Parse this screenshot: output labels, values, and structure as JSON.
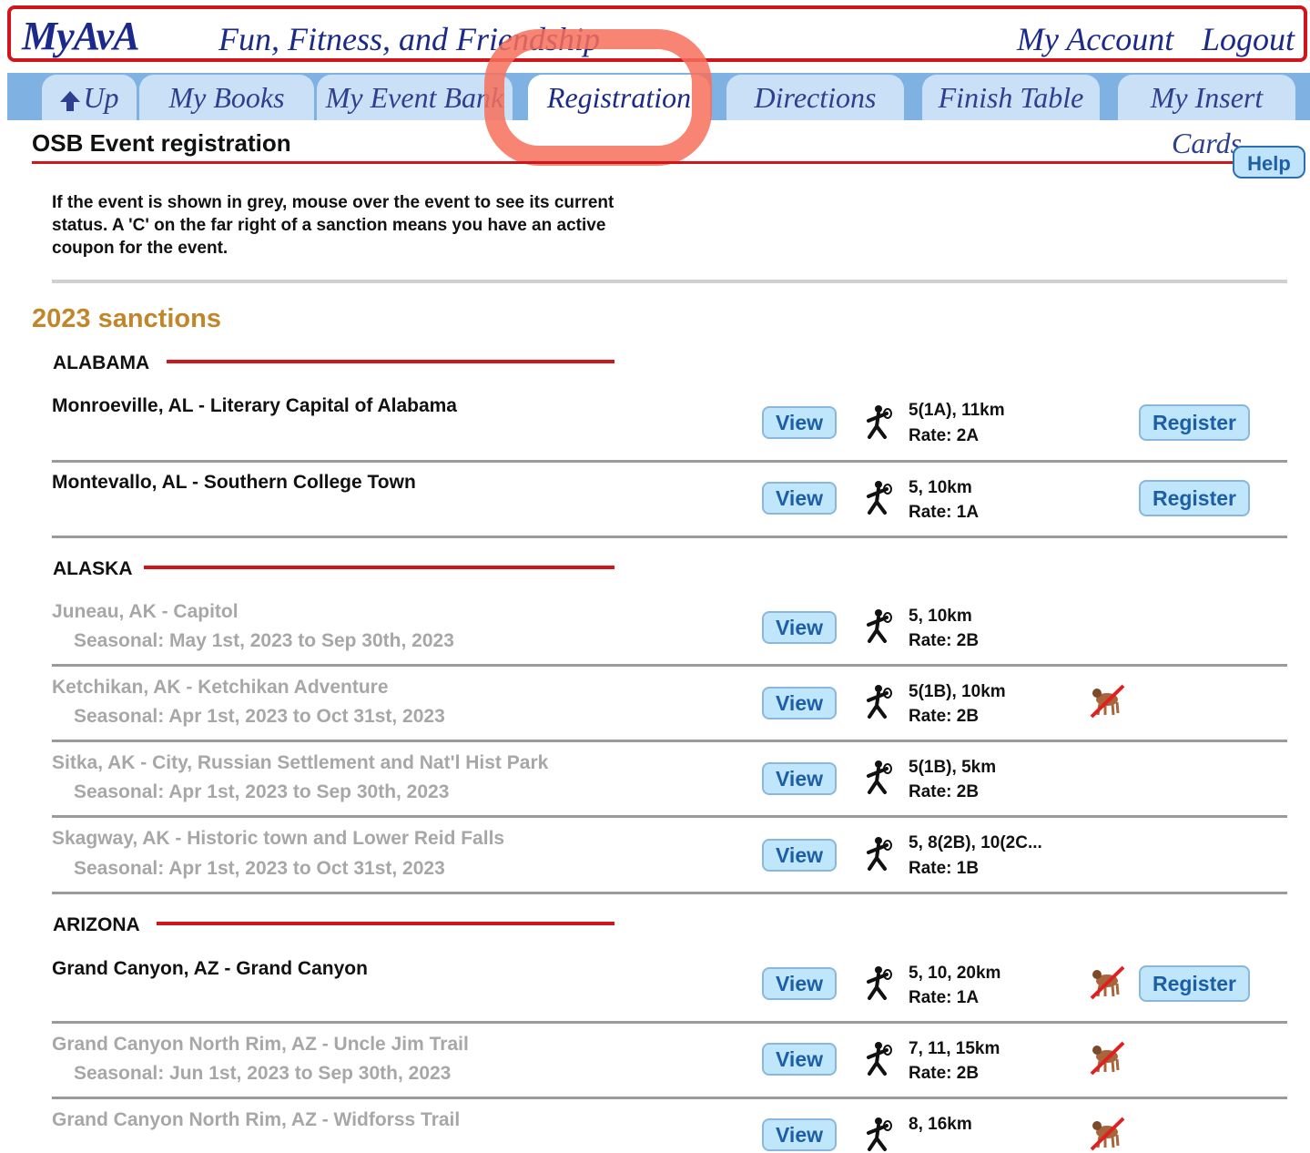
{
  "header": {
    "logo_my": "My",
    "logo_ava": "AvA",
    "tagline": "Fun, Fitness, and Friendship",
    "my_account": "My Account",
    "logout": "Logout"
  },
  "tabs": [
    {
      "label": "Up",
      "icon": "arrow-up-icon"
    },
    {
      "label": "My Books"
    },
    {
      "label": "My Event Bank"
    },
    {
      "label": "Registration",
      "active": true
    },
    {
      "label": "Directions"
    },
    {
      "label": "Finish Table"
    },
    {
      "label": "My Insert Cards"
    }
  ],
  "page": {
    "title": "OSB Event registration",
    "help": "Help",
    "intro": "If the event is shown in grey, mouse over the event to see its current status. A 'C' on the far right of a sanction means you have an active coupon for the event.",
    "year_heading": "2023 sanctions"
  },
  "labels": {
    "view": "View",
    "register": "Register"
  },
  "states": [
    {
      "name": "ALABAMA"
    },
    {
      "name": "ALASKA"
    },
    {
      "name": "ARIZONA"
    }
  ],
  "events": [
    {
      "name": "Monroeville, AL - Literary Capital of Alabama",
      "distance": "5(1A), 11km",
      "rate": "Rate: 2A",
      "register": true,
      "no_dogs": false,
      "grey": false
    },
    {
      "name": "Montevallo, AL - Southern College Town",
      "distance": "5, 10km",
      "rate": "Rate: 1A",
      "register": true,
      "no_dogs": false,
      "grey": false
    },
    {
      "name": "Juneau, AK - Capitol",
      "seasonal": "Seasonal: May 1st, 2023 to Sep 30th, 2023",
      "distance": "5, 10km",
      "rate": "Rate: 2B",
      "register": false,
      "no_dogs": false,
      "grey": true
    },
    {
      "name": "Ketchikan, AK - Ketchikan Adventure",
      "seasonal": "Seasonal: Apr 1st, 2023 to Oct 31st, 2023",
      "distance": "5(1B), 10km",
      "rate": "Rate: 2B",
      "register": false,
      "no_dogs": true,
      "grey": true
    },
    {
      "name": "Sitka, AK - City, Russian Settlement and Nat'l Hist Park",
      "seasonal": "Seasonal: Apr 1st, 2023 to Sep 30th, 2023",
      "distance": "5(1B), 5km",
      "rate": "Rate: 2B",
      "register": false,
      "no_dogs": false,
      "grey": true
    },
    {
      "name": "Skagway, AK - Historic town and Lower Reid Falls",
      "seasonal": "Seasonal: Apr 1st, 2023 to Oct 31st, 2023",
      "distance": "5, 8(2B), 10(2C...",
      "rate": "Rate: 1B",
      "register": false,
      "no_dogs": false,
      "grey": true
    },
    {
      "name": "Grand Canyon, AZ - Grand Canyon",
      "distance": "5, 10, 20km",
      "rate": "Rate: 1A",
      "register": true,
      "no_dogs": true,
      "grey": false
    },
    {
      "name": "Grand Canyon North Rim, AZ - Uncle Jim Trail",
      "seasonal": "Seasonal: Jun 1st, 2023 to Sep 30th, 2023",
      "distance": "7, 11, 15km",
      "rate": "Rate: 2B",
      "register": false,
      "no_dogs": true,
      "grey": true
    },
    {
      "name": "Grand Canyon North Rim, AZ - Widforss Trail",
      "distance": "8, 16km",
      "register": false,
      "no_dogs": true,
      "grey": true
    }
  ],
  "colors": {
    "accent_red": "#d0151b",
    "nav_blue": "#1b2a8a",
    "button_bg": "#bfe6fb",
    "year_gold": "#c2862a",
    "grey_text": "#a7a7a7"
  }
}
